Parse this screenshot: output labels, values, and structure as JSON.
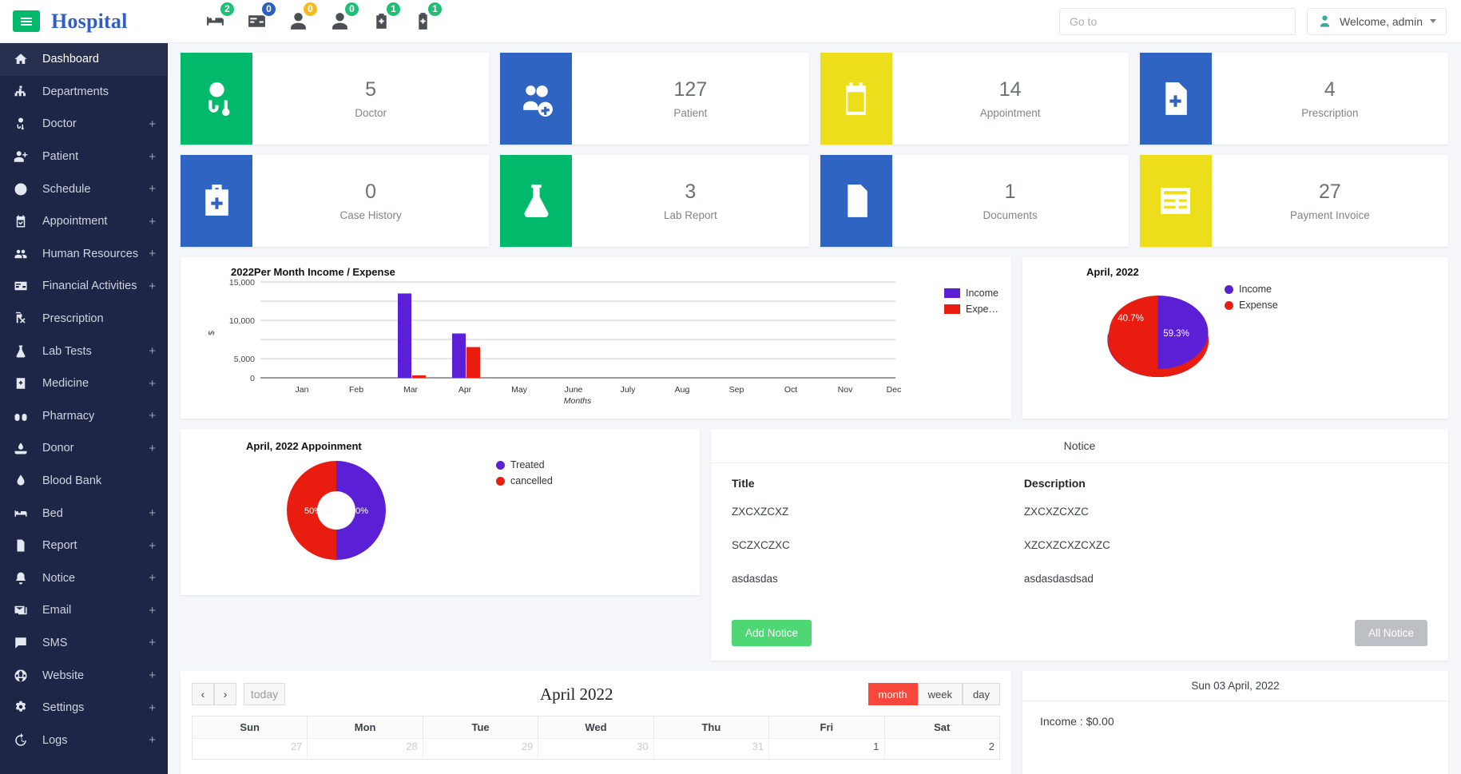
{
  "header": {
    "brand": "Hospital",
    "menu_icon": "hamburger-icon",
    "quick_icons": [
      {
        "name": "bed-icon",
        "count": "2",
        "color": "green"
      },
      {
        "name": "card-icon",
        "count": "0",
        "color": "blue"
      },
      {
        "name": "user-icon",
        "count": "0",
        "color": "amber"
      },
      {
        "name": "user-alt-icon",
        "count": "0",
        "color": "green"
      },
      {
        "name": "medkit-icon",
        "count": "1",
        "color": "green"
      },
      {
        "name": "clipboard-plus-icon",
        "count": "1",
        "color": "green"
      }
    ],
    "search": {
      "placeholder": "Go to",
      "value": ""
    },
    "user": {
      "label": "Welcome, admin",
      "icon": "doctor-avatar-icon"
    }
  },
  "sidebar": {
    "items": [
      {
        "label": "Dashboard",
        "icon": "home-icon",
        "expandable": false,
        "active": true
      },
      {
        "label": "Departments",
        "icon": "sitemap-icon",
        "expandable": false,
        "active": false
      },
      {
        "label": "Doctor",
        "icon": "doctor-icon",
        "expandable": true,
        "active": false
      },
      {
        "label": "Patient",
        "icon": "user-plus-icon",
        "expandable": true,
        "active": false
      },
      {
        "label": "Schedule",
        "icon": "clock-icon",
        "expandable": true,
        "active": false
      },
      {
        "label": "Appointment",
        "icon": "calendar-check-icon",
        "expandable": true,
        "active": false
      },
      {
        "label": "Human Resources",
        "icon": "users-icon",
        "expandable": true,
        "active": false
      },
      {
        "label": "Financial Activities",
        "icon": "credit-card-icon",
        "expandable": true,
        "active": false
      },
      {
        "label": "Prescription",
        "icon": "prescription-icon",
        "expandable": false,
        "active": false
      },
      {
        "label": "Lab Tests",
        "icon": "flask-icon",
        "expandable": true,
        "active": false
      },
      {
        "label": "Medicine",
        "icon": "medicine-icon",
        "expandable": true,
        "active": false
      },
      {
        "label": "Pharmacy",
        "icon": "pills-icon",
        "expandable": true,
        "active": false
      },
      {
        "label": "Donor",
        "icon": "hand-drop-icon",
        "expandable": true,
        "active": false
      },
      {
        "label": "Blood Bank",
        "icon": "blood-drop-icon",
        "expandable": false,
        "active": false
      },
      {
        "label": "Bed",
        "icon": "bed-icon",
        "expandable": true,
        "active": false
      },
      {
        "label": "Report",
        "icon": "report-icon",
        "expandable": true,
        "active": false
      },
      {
        "label": "Notice",
        "icon": "bell-icon",
        "expandable": true,
        "active": false
      },
      {
        "label": "Email",
        "icon": "email-icon",
        "expandable": true,
        "active": false
      },
      {
        "label": "SMS",
        "icon": "sms-icon",
        "expandable": true,
        "active": false
      },
      {
        "label": "Website",
        "icon": "globe-icon",
        "expandable": true,
        "active": false
      },
      {
        "label": "Settings",
        "icon": "gears-icon",
        "expandable": true,
        "active": false
      },
      {
        "label": "Logs",
        "icon": "history-icon",
        "expandable": true,
        "active": false
      }
    ],
    "expand_symbol": "+"
  },
  "stats": [
    {
      "value": "5",
      "label": "Doctor",
      "icon": "doctor-icon",
      "color": "#00b96b",
      "bg": "bg-green"
    },
    {
      "value": "127",
      "label": "Patient",
      "icon": "patients-icon",
      "color": "#2f64c2",
      "bg": "bg-blue"
    },
    {
      "value": "14",
      "label": "Appointment",
      "icon": "calendar-icon",
      "color": "#edde1c",
      "bg": "bg-yellow"
    },
    {
      "value": "4",
      "label": "Prescription",
      "icon": "file-plus-icon",
      "color": "#2f64c2",
      "bg": "bg-blue"
    },
    {
      "value": "0",
      "label": "Case History",
      "icon": "medkit-icon",
      "color": "#2f64c2",
      "bg": "bg-blue"
    },
    {
      "value": "3",
      "label": "Lab Report",
      "icon": "flask-icon",
      "color": "#00b96b",
      "bg": "bg-green"
    },
    {
      "value": "1",
      "label": "Documents",
      "icon": "file-icon",
      "color": "#2f64c2",
      "bg": "bg-blue"
    },
    {
      "value": "27",
      "label": "Payment Invoice",
      "icon": "credit-card-icon",
      "color": "#edde1c",
      "bg": "bg-yellow"
    }
  ],
  "chart_data": [
    {
      "type": "bar",
      "title": "2022Per Month Income / Expense",
      "xlabel": "Months",
      "ylabel": "$",
      "categories": [
        "Jan",
        "Feb",
        "Mar",
        "Apr",
        "May",
        "June",
        "July",
        "Aug",
        "Sep",
        "Oct",
        "Nov",
        "Dec"
      ],
      "yticks": [
        "0",
        "5,000",
        "10,000",
        "15,000"
      ],
      "ylim": [
        0,
        15000
      ],
      "grid": true,
      "legend_position": "right",
      "series": [
        {
          "name": "Income",
          "label": "Income",
          "color": "#5b20d6",
          "values": [
            0,
            0,
            13700,
            7200,
            0,
            0,
            0,
            0,
            0,
            0,
            0,
            0
          ]
        },
        {
          "name": "Expense",
          "label": "Expe…",
          "color": "#e81d10",
          "values": [
            0,
            0,
            400,
            5000,
            0,
            0,
            0,
            0,
            0,
            0,
            0,
            0
          ]
        }
      ]
    },
    {
      "type": "pie",
      "title": "April, 2022",
      "legend_position": "right",
      "slices": [
        {
          "name": "Income",
          "value": 59.3,
          "label": "59.3%",
          "color": "#5b20d6"
        },
        {
          "name": "Expense",
          "value": 40.7,
          "label": "40.7%",
          "color": "#e81d10"
        }
      ]
    },
    {
      "type": "pie",
      "subtype": "donut",
      "title": "April, 2022 Appoinment",
      "legend_position": "right",
      "slices": [
        {
          "name": "Treated",
          "value": 50,
          "label": "50%",
          "color": "#5b20d6"
        },
        {
          "name": "cancelled",
          "value": 50,
          "label": "50%",
          "color": "#e81d10"
        }
      ]
    }
  ],
  "notice": {
    "panel_title": "Notice",
    "columns": [
      "Title",
      "Description"
    ],
    "rows": [
      {
        "title": "ZXCXZCXZ",
        "description": "ZXCXZCXZC"
      },
      {
        "title": "SCZXCZXC",
        "description": "XZCXZCXZCXZC"
      },
      {
        "title": "asdasdas",
        "description": "asdasdasdsad"
      }
    ],
    "add_button": "Add Notice",
    "all_button": "All Notice"
  },
  "calendar": {
    "prev_label": "‹",
    "next_label": "›",
    "today_label": "today",
    "title": "April 2022",
    "views": [
      {
        "label": "month",
        "active": true
      },
      {
        "label": "week",
        "active": false
      },
      {
        "label": "day",
        "active": false
      }
    ],
    "weekdays": [
      "Sun",
      "Mon",
      "Tue",
      "Wed",
      "Thu",
      "Fri",
      "Sat"
    ],
    "first_row": [
      {
        "day": "27",
        "current_month": false
      },
      {
        "day": "28",
        "current_month": false
      },
      {
        "day": "29",
        "current_month": false
      },
      {
        "day": "30",
        "current_month": false
      },
      {
        "day": "31",
        "current_month": false
      },
      {
        "day": "1",
        "current_month": true
      },
      {
        "day": "2",
        "current_month": true
      }
    ]
  },
  "day_detail": {
    "title": "Sun 03 April, 2022",
    "income_line": "Income : $0.00"
  }
}
